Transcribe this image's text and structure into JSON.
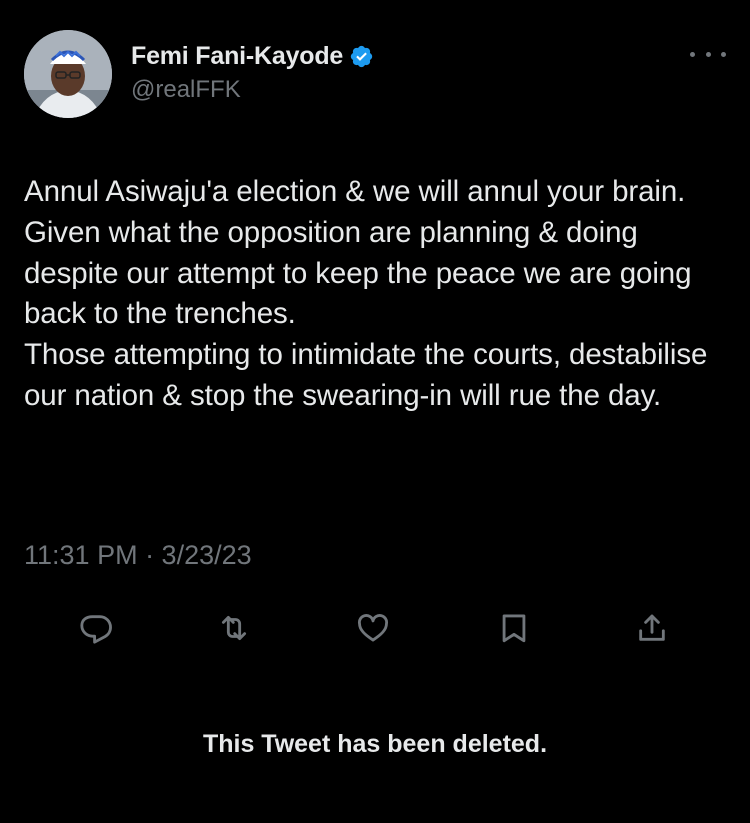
{
  "tweet": {
    "author": {
      "display_name": "Femi Fani-Kayode",
      "handle": "@realFFK",
      "verified": true,
      "avatar_icon": "profile-photo"
    },
    "text": "Annul Asiwaju'a election & we will annul your brain. Given what the opposition are planning & doing despite our attempt to keep the peace we are going back to the trenches.\nThose attempting to intimidate the courts, destabilise our nation & stop the swearing-in will rue the day.",
    "timestamp": "11:31 PM · 3/23/23"
  },
  "actions": {
    "reply": "reply-icon",
    "retweet": "retweet-icon",
    "like": "like-icon",
    "bookmark": "bookmark-icon",
    "share": "share-icon"
  },
  "notice": "This Tweet has been deleted.",
  "colors": {
    "background": "#000000",
    "text": "#e7e9ea",
    "secondary": "#71767b",
    "verified": "#1d9bf0"
  }
}
